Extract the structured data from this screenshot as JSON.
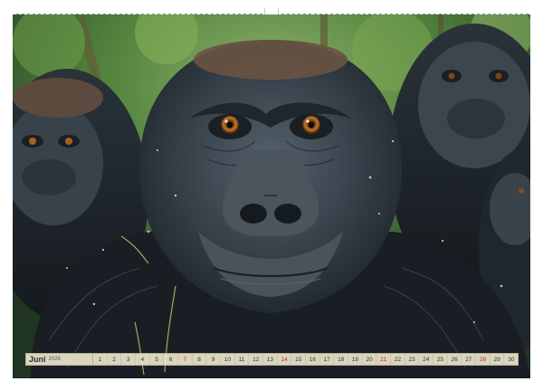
{
  "calendar": {
    "month": "Juni",
    "year": "2026",
    "days": [
      {
        "n": "1",
        "sun": false
      },
      {
        "n": "2",
        "sun": false
      },
      {
        "n": "3",
        "sun": false
      },
      {
        "n": "4",
        "sun": false
      },
      {
        "n": "5",
        "sun": false
      },
      {
        "n": "6",
        "sun": false
      },
      {
        "n": "7",
        "sun": true
      },
      {
        "n": "8",
        "sun": false
      },
      {
        "n": "9",
        "sun": false
      },
      {
        "n": "10",
        "sun": false
      },
      {
        "n": "11",
        "sun": false
      },
      {
        "n": "12",
        "sun": false
      },
      {
        "n": "13",
        "sun": false
      },
      {
        "n": "14",
        "sun": true
      },
      {
        "n": "15",
        "sun": false
      },
      {
        "n": "16",
        "sun": false
      },
      {
        "n": "17",
        "sun": false
      },
      {
        "n": "18",
        "sun": false
      },
      {
        "n": "19",
        "sun": false
      },
      {
        "n": "20",
        "sun": false
      },
      {
        "n": "21",
        "sun": true
      },
      {
        "n": "22",
        "sun": false
      },
      {
        "n": "23",
        "sun": false
      },
      {
        "n": "24",
        "sun": false
      },
      {
        "n": "25",
        "sun": false
      },
      {
        "n": "26",
        "sun": false
      },
      {
        "n": "27",
        "sun": false
      },
      {
        "n": "28",
        "sun": true
      },
      {
        "n": "29",
        "sun": false
      },
      {
        "n": "30",
        "sun": false
      }
    ]
  },
  "colors": {
    "sunday": "#c0282a",
    "strip_bg": "#f5eed7",
    "fur_dark": "#1f262c",
    "fur_mid": "#3b464f",
    "eye": "#b0661e",
    "foliage": "#4e7f3a"
  }
}
